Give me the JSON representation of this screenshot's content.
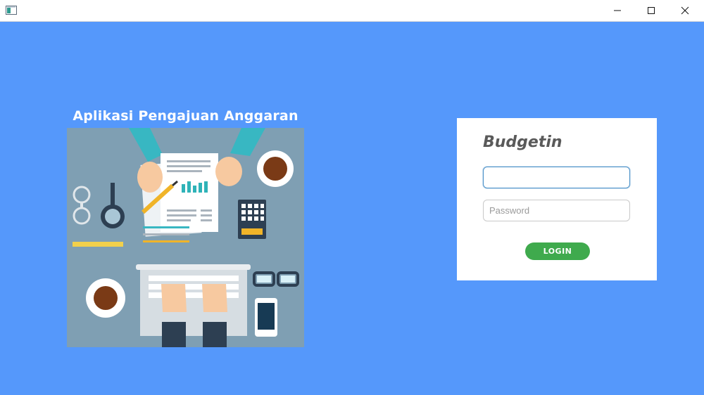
{
  "window": {
    "icons": {
      "app": "app-window-icon",
      "minimize": "minimize-icon",
      "maximize": "maximize-icon",
      "close": "close-icon"
    }
  },
  "left": {
    "title": "Aplikasi Pengajuan Anggaran",
    "illustration": "office-desk-illustration"
  },
  "login": {
    "brand": "Budgetin",
    "username": {
      "value": "",
      "placeholder": ""
    },
    "password": {
      "value": "",
      "placeholder": "Password"
    },
    "button_label": "LOGIN"
  },
  "colors": {
    "background": "#5598fb",
    "button": "#3faa4d",
    "brand_text": "#5a5a5a"
  }
}
